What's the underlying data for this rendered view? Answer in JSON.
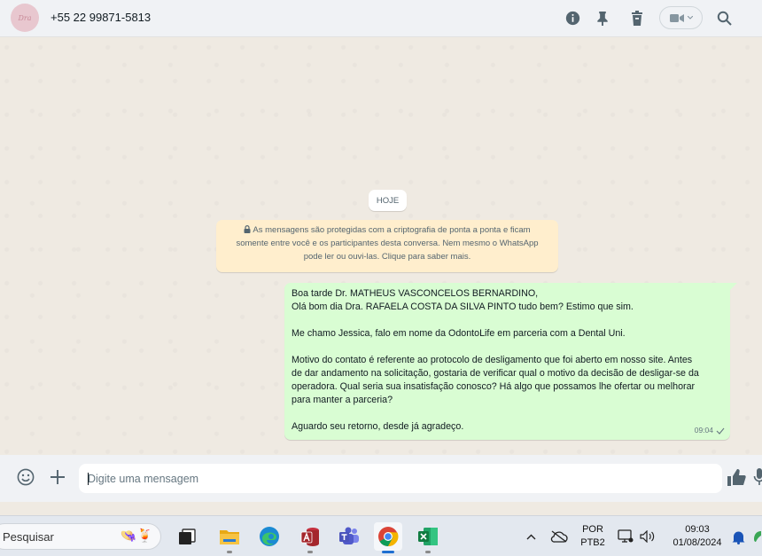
{
  "header": {
    "avatar_text": "Dra",
    "contact_name": "+55 22 99871-5813"
  },
  "chat": {
    "date_chip": "HOJE",
    "encryption_notice_lines": [
      "As mensagens são protegidas com a criptografia de ponta a ponta e ficam",
      "somente entre você e os participantes desta conversa. Nem mesmo o WhatsApp",
      "pode ler ou ouvi-las. Clique para saber mais."
    ],
    "message": {
      "paragraphs": [
        "Boa tarde Dr. MATHEUS VASCONCELOS BERNARDINO,\nOlá bom dia Dra. RAFAELA COSTA DA SILVA PINTO tudo bem? Estimo que sim.",
        "Me chamo Jessica, falo em nome da OdontoLife em parceria com a Dental Uni.",
        "Motivo do contato é referente ao protocolo de desligamento que  foi aberto em nosso site. Antes\nde dar andamento na solicitação, gostaria de verificar qual o motivo da decisão de desligar-se da\noperadora. Qual seria sua insatisfação conosco? Há algo que possamos lhe ofertar ou melhorar\npara manter a parceria?",
        "Aguardo seu retorno, desde já agradeço."
      ],
      "time": "09:04",
      "status": "sent"
    }
  },
  "composer": {
    "placeholder": "Digite uma mensagem"
  },
  "taskbar": {
    "search_label": "Pesquisar",
    "language_top": "POR",
    "language_bottom": "PTB2",
    "time": "09:03",
    "date": "01/08/2024"
  },
  "colors": {
    "outgoing_bubble": "#d9fdd3",
    "notice_bg": "#ffeecd",
    "chat_bg": "#efeae2",
    "header_bg": "#f0f2f5"
  }
}
